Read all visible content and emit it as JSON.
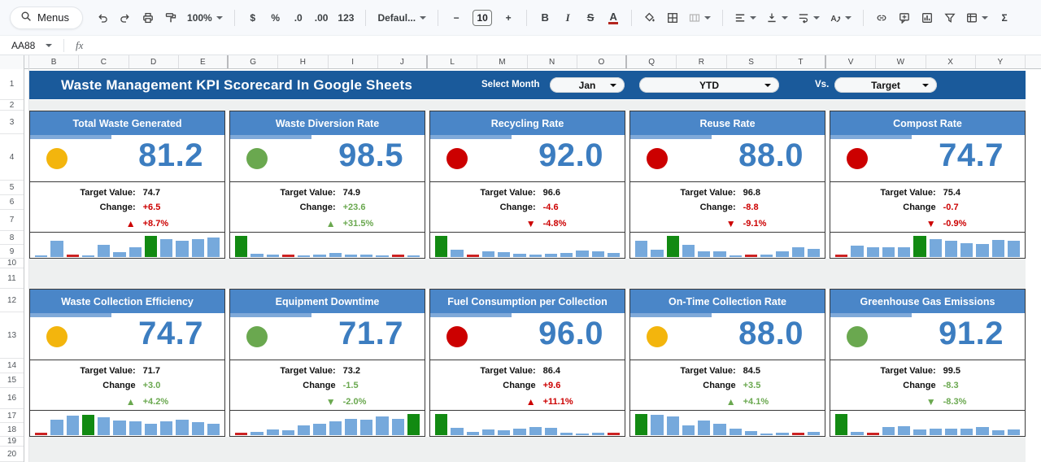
{
  "colors": {
    "banner_bg": "#1A5A9B",
    "card_header_bg": "#4A86C8",
    "value_blue": "#3C7DC0",
    "bar_blue": "#76A9DC",
    "bar_green": "#128A12",
    "bar_red": "#CC2222",
    "status_red": "#CC0000",
    "status_green": "#6AA84F",
    "status_yellow": "#F3B50D"
  },
  "toolbar": {
    "menus_label": "Menus",
    "items": [
      {
        "name": "undo-button",
        "icon": "undo"
      },
      {
        "name": "redo-button",
        "icon": "redo"
      },
      {
        "name": "print-button",
        "icon": "print"
      },
      {
        "name": "paint-format-button",
        "icon": "roller"
      },
      {
        "name": "zoom-select",
        "label": "100%",
        "dd": true
      },
      {
        "sep": true
      },
      {
        "name": "format-currency-button",
        "label": "$"
      },
      {
        "name": "format-percent-button",
        "label": "%"
      },
      {
        "name": "decrease-decimals-button",
        "label": ".0"
      },
      {
        "name": "increase-decimals-button",
        "label": ".00"
      },
      {
        "name": "more-formats-button",
        "label": "123"
      },
      {
        "sep": true
      },
      {
        "name": "font-select",
        "label": "Defaul...",
        "dd": true
      },
      {
        "sep": true
      },
      {
        "name": "decrease-font-size-button",
        "label": "−"
      },
      {
        "name": "font-size-input",
        "label": "10",
        "boxed": true
      },
      {
        "name": "increase-font-size-button",
        "label": "+"
      },
      {
        "sep": true
      },
      {
        "name": "bold-button",
        "label": "B",
        "cls": "b"
      },
      {
        "name": "italic-button",
        "label": "I",
        "cls": "i"
      },
      {
        "name": "strikethrough-button",
        "label": "S",
        "cls": "s"
      },
      {
        "name": "text-color-button",
        "label": "A",
        "cls": "u"
      },
      {
        "sep": true
      },
      {
        "name": "fill-color-button",
        "icon": "fill"
      },
      {
        "name": "borders-button",
        "icon": "borders"
      },
      {
        "name": "merge-cells-button",
        "icon": "merge",
        "dd": true
      },
      {
        "sep": true
      },
      {
        "name": "horizontal-align-button",
        "icon": "align",
        "dd": true
      },
      {
        "name": "vertical-align-button",
        "icon": "valign",
        "dd": true
      },
      {
        "name": "text-wrapping-button",
        "icon": "wrap",
        "dd": true
      },
      {
        "name": "text-rotation-button",
        "icon": "rotate",
        "dd": true
      },
      {
        "sep": true
      },
      {
        "name": "insert-link-button",
        "icon": "link"
      },
      {
        "name": "insert-comment-button",
        "icon": "comment"
      },
      {
        "name": "insert-chart-button",
        "icon": "chart"
      },
      {
        "name": "create-filter-button",
        "icon": "filter"
      },
      {
        "name": "table-button",
        "icon": "table",
        "dd": true
      },
      {
        "name": "functions-button",
        "label": "Σ"
      }
    ]
  },
  "formula_bar": {
    "name_box": "AA88",
    "fx_label": "fx"
  },
  "grid": {
    "columns": [
      "B",
      "C",
      "D",
      "E",
      "G",
      "H",
      "I",
      "J",
      "L",
      "M",
      "N",
      "O",
      "Q",
      "R",
      "S",
      "T",
      "V",
      "W",
      "X",
      "Y"
    ],
    "group_breaks": [
      3,
      7,
      11,
      15
    ],
    "rows": [
      "1",
      "2",
      "3",
      "4",
      "5",
      "6",
      "7",
      "8",
      "9",
      "10",
      "11",
      "12",
      "13",
      "14",
      "15",
      "16",
      "17",
      "18",
      "19",
      "20"
    ]
  },
  "banner": {
    "title": "Waste Management KPI Scorecard In Google Sheets",
    "select_month_label": "Select Month",
    "month_value": "Jan",
    "period_value": "YTD",
    "vs_label": "Vs.",
    "compare_value": "Target"
  },
  "cards": [
    {
      "title": "Total Waste Generated",
      "value": "81.2",
      "dot": "#F3B50D",
      "target_label": "Target Value:",
      "target": "74.7",
      "change_label": "Change:",
      "change": "+6.5",
      "change_color": "#CC0000",
      "arrow": "▲",
      "arrow_color": "#CC0000",
      "pct": "+8.7%",
      "pct_color": "#CC0000",
      "spark": [
        5,
        75,
        -4,
        8,
        57,
        22,
        45,
        100,
        85,
        77,
        85,
        93
      ],
      "green": 7
    },
    {
      "title": "Waste Diversion Rate",
      "value": "98.5",
      "dot": "#6AA84F",
      "target_label": "Target Value:",
      "target": "74.9",
      "change_label": "Change:",
      "change": "+23.6",
      "change_color": "#6AA84F",
      "arrow": "▲",
      "arrow_color": "#6AA84F",
      "pct": "+31.5%",
      "pct_color": "#6AA84F",
      "spark": [
        100,
        15,
        12,
        -4,
        8,
        10,
        20,
        12,
        13,
        8,
        -4,
        6
      ],
      "green": 0
    },
    {
      "title": "Recycling Rate",
      "value": "92.0",
      "dot": "#CC0000",
      "target_label": "Target Value:",
      "target": "96.6",
      "change_label": "Change:",
      "change": "-4.6",
      "change_color": "#CC0000",
      "arrow": "▼",
      "arrow_color": "#CC0000",
      "pct": "-4.8%",
      "pct_color": "#CC0000",
      "spark": [
        100,
        35,
        -4,
        28,
        22,
        16,
        12,
        15,
        20,
        30,
        25,
        20
      ],
      "green": 0
    },
    {
      "title": "Reuse Rate",
      "value": "88.0",
      "dot": "#CC0000",
      "target_label": "Target Value:",
      "target": "96.8",
      "change_label": "Change:",
      "change": "-8.8",
      "change_color": "#CC0000",
      "arrow": "▼",
      "arrow_color": "#CC0000",
      "pct": "-9.1%",
      "pct_color": "#CC0000",
      "spark": [
        75,
        35,
        100,
        58,
        25,
        28,
        8,
        -4,
        10,
        28,
        46,
        40
      ],
      "green": 2
    },
    {
      "title": "Compost Rate",
      "value": "74.7",
      "dot": "#CC0000",
      "target_label": "Target Value:",
      "target": "75.4",
      "change_label": "Change",
      "change": "-0.7",
      "change_color": "#CC0000",
      "arrow": "▼",
      "arrow_color": "#CC0000",
      "pct": "-0.9%",
      "pct_color": "#CC0000",
      "spark": [
        -4,
        55,
        48,
        48,
        48,
        100,
        85,
        75,
        66,
        62,
        80,
        76
      ],
      "green": 5
    },
    {
      "title": "Waste Collection Efficiency",
      "value": "74.7",
      "dot": "#F3B50D",
      "target_label": "Target Value:",
      "target": "71.7",
      "change_label": "Change",
      "change": "+3.0",
      "change_color": "#6AA84F",
      "arrow": "▲",
      "arrow_color": "#6AA84F",
      "pct": "+4.2%",
      "pct_color": "#6AA84F",
      "spark": [
        -4,
        72,
        92,
        97,
        85,
        68,
        66,
        55,
        66,
        73,
        60,
        55
      ],
      "green": 3
    },
    {
      "title": "Equipment Downtime",
      "value": "71.7",
      "dot": "#6AA84F",
      "target_label": "Target Value:",
      "target": "73.2",
      "change_label": "Change",
      "change": "-1.5",
      "change_color": "#6AA84F",
      "arrow": "▼",
      "arrow_color": "#6AA84F",
      "pct": "-2.0%",
      "pct_color": "#6AA84F",
      "spark": [
        -4,
        15,
        28,
        22,
        45,
        55,
        65,
        78,
        72,
        88,
        78,
        100
      ],
      "green": 11
    },
    {
      "title": "Fuel Consumption per Collection",
      "value": "96.0",
      "dot": "#CC0000",
      "target_label": "Target Value:",
      "target": "86.4",
      "change_label": "Change",
      "change": "+9.6",
      "change_color": "#CC0000",
      "arrow": "▲",
      "arrow_color": "#CC0000",
      "pct": "+11.1%",
      "pct_color": "#CC0000",
      "spark": [
        100,
        35,
        15,
        28,
        22,
        32,
        40,
        33,
        12,
        8,
        10,
        -4
      ],
      "green": 0
    },
    {
      "title": "On-Time Collection Rate",
      "value": "88.0",
      "dot": "#F3B50D",
      "target_label": "Target Value:",
      "target": "84.5",
      "change_label": "Change",
      "change": "+3.5",
      "change_color": "#6AA84F",
      "arrow": "▲",
      "arrow_color": "#6AA84F",
      "pct": "+4.1%",
      "pct_color": "#6AA84F",
      "spark": [
        100,
        95,
        88,
        48,
        68,
        55,
        30,
        20,
        6,
        12,
        -4,
        15
      ],
      "green": 0
    },
    {
      "title": "Greenhouse Gas Emissions",
      "value": "91.2",
      "dot": "#6AA84F",
      "target_label": "Target Value:",
      "target": "99.5",
      "change_label": "Change",
      "change": "-8.3",
      "change_color": "#6AA84F",
      "arrow": "▼",
      "arrow_color": "#6AA84F",
      "pct": "-8.3%",
      "pct_color": "#6AA84F",
      "spark": [
        100,
        15,
        -4,
        40,
        43,
        28,
        32,
        30,
        32,
        38,
        22,
        28
      ],
      "green": 0
    }
  ]
}
